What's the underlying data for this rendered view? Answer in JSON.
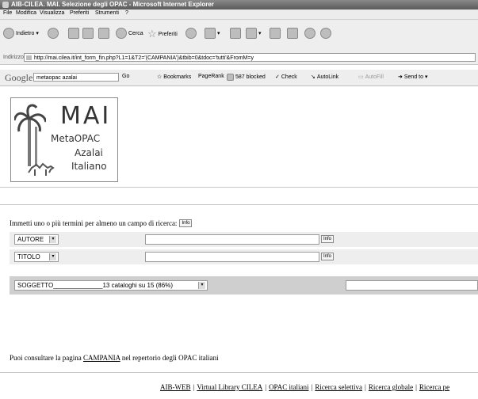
{
  "window": {
    "title": "AIB-CILEA. MAI. Selezione degli OPAC - Microsoft Internet Explorer"
  },
  "menu": [
    "File",
    "Modifica",
    "Visualizza",
    "Preferiti",
    "Strumenti",
    "?"
  ],
  "toolbar": {
    "back_label": "Indietro",
    "search_label": "Cerca",
    "favorites_label": "Preferiti"
  },
  "address": {
    "label": "Indirizzo",
    "url": "http://mai.cilea.it/int_form_fin.php?L1=1&T2='(CAMPANIA')&tbib=0&tdoc='tutti'&FromM=y"
  },
  "google_bar": {
    "logo": "Google",
    "search_value": "metaopac azalai",
    "go_label": "Go",
    "bookmarks_label": "Bookmarks",
    "pagerank_label": "PageRank",
    "blocked_label": "587 blocked",
    "check_label": "Check",
    "autolink_label": "AutoLink",
    "autofill_label": "AutoFill",
    "sendto_label": "Send to"
  },
  "logo": {
    "line1": "MAI",
    "line2": "MetaOPAC",
    "line3": "Azalai",
    "line4": "Italiano"
  },
  "form": {
    "prompt": "Immetti uno o più termini per almeno un campo di ricerca:",
    "info_label": "Info",
    "field1": {
      "selected": "AUTORE",
      "value": ""
    },
    "field2": {
      "selected": "TITOLO",
      "value": ""
    },
    "soggetto": {
      "selected": "SOGGETTO______________13 cataloghi su 15 (86%)",
      "value": ""
    }
  },
  "bottom": {
    "text_prefix": "Puoi consultare la pagina",
    "link": "CAMPANIA",
    "text_suffix": "nel repertorio degli OPAC italiani"
  },
  "footer_links": [
    "AIB-WEB",
    "Virtual Library CILEA",
    "OPAC italiani",
    "Ricerca selettiva",
    "Ricerca globale",
    "Ricerca pe"
  ]
}
